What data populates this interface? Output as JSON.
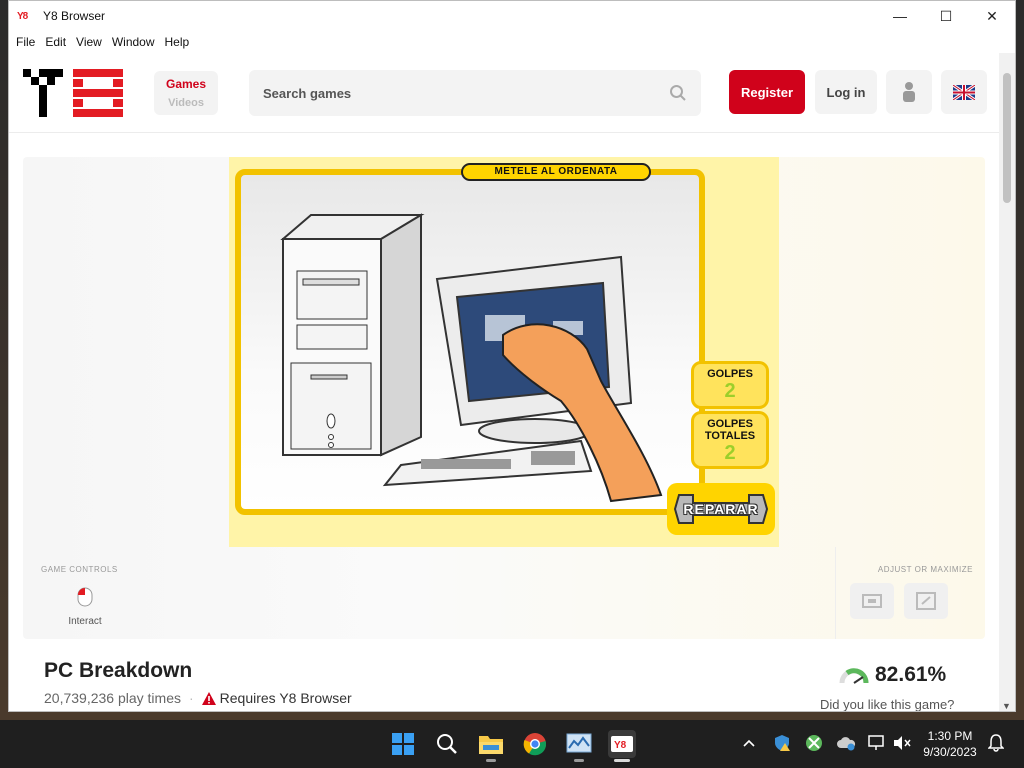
{
  "window": {
    "title": "Y8 Browser",
    "controls": {
      "minimize": "—",
      "maximize": "☐",
      "close": "✕"
    }
  },
  "menu": [
    "File",
    "Edit",
    "View",
    "Window",
    "Help"
  ],
  "header": {
    "categories": {
      "games": "Games",
      "videos": "Videos"
    },
    "search": {
      "placeholder": "Search games"
    },
    "register": "Register",
    "login": "Log in"
  },
  "game": {
    "banner": "METELE AL ORDENATA",
    "counters": [
      {
        "label": "GOLPES",
        "value": "2"
      },
      {
        "label": "GOLPES TOTALES",
        "value": "2"
      }
    ],
    "repair": "REPARAR"
  },
  "controls": {
    "left_title": "GAME CONTROLS",
    "interact": "Interact",
    "right_title": "ADJUST OR MAXIMIZE"
  },
  "info": {
    "title": "PC Breakdown",
    "plays": "20,739,236 play times",
    "requires": "Requires Y8 Browser",
    "rating": "82.61%",
    "rating_question": "Did you like this game?"
  },
  "taskbar": {
    "time": "1:30 PM",
    "date": "9/30/2023"
  },
  "colors": {
    "brand_red": "#d0021b",
    "game_yellow": "#ffd400"
  }
}
